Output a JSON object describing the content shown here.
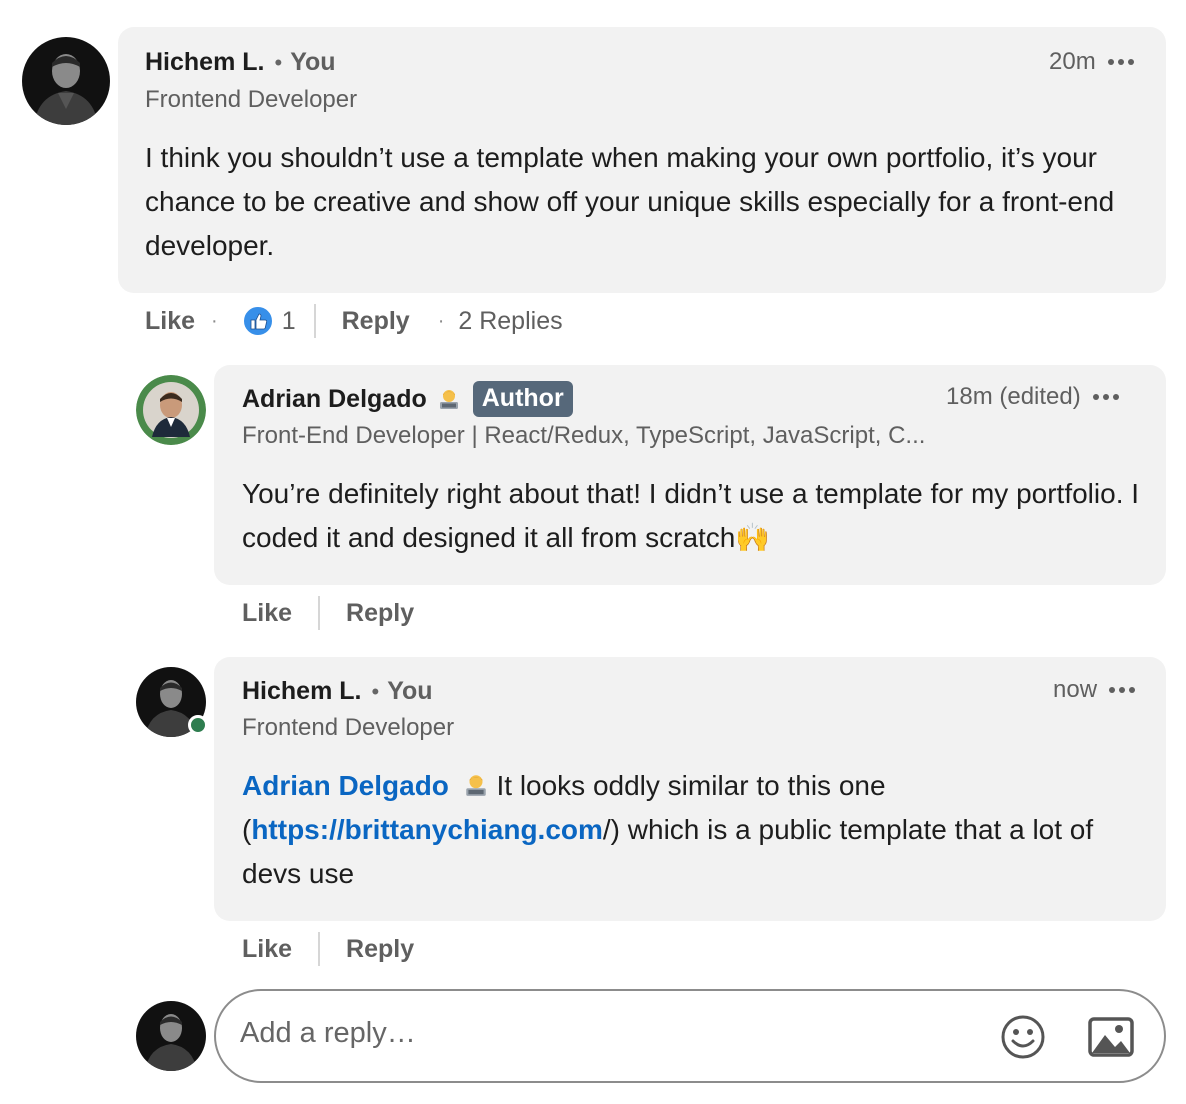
{
  "comment": {
    "author": "Hichem L.",
    "separator": "•",
    "you_label": "You",
    "headline": "Frontend Developer",
    "time": "20m",
    "text": "I think you shouldn’t use a template when making your own portfolio, it’s your chance to be creative and show off your unique skills especially for a front-end developer.",
    "actions": {
      "like_label": "Like",
      "dot": "·",
      "reaction_count": "1",
      "reply_label": "Reply",
      "replies_label": "2 Replies"
    }
  },
  "replies": [
    {
      "author": "Adrian Delgado",
      "emoji_icon": "technologist-emoji",
      "badge": "Author",
      "headline": "Front-End Developer | React/Redux, TypeScript, JavaScript, C...",
      "time": "18m (edited)",
      "text": "You’re definitely right about that! I didn’t use a template for my portfolio. I coded it and designed it all from scratch🙌",
      "actions": {
        "like_label": "Like",
        "reply_label": "Reply"
      }
    },
    {
      "author": "Hichem L.",
      "separator": "•",
      "you_label": "You",
      "headline": "Frontend Developer",
      "time": "now",
      "mention": "Adrian Delgado",
      "text_after_mention": " It looks oddly similar to this one (",
      "link": "https://brittanychiang.com",
      "text_after_link": "/) which is a public template that a lot of devs use",
      "actions": {
        "like_label": "Like",
        "reply_label": "Reply"
      }
    }
  ],
  "reply_box": {
    "placeholder": "Add a reply…",
    "emoji_icon": "smiley-icon",
    "image_icon": "image-icon"
  },
  "colors": {
    "link": "#0a66c2",
    "bubble": "#f2f2f2",
    "author_badge": "#56687a",
    "online": "#2e7d4f"
  }
}
